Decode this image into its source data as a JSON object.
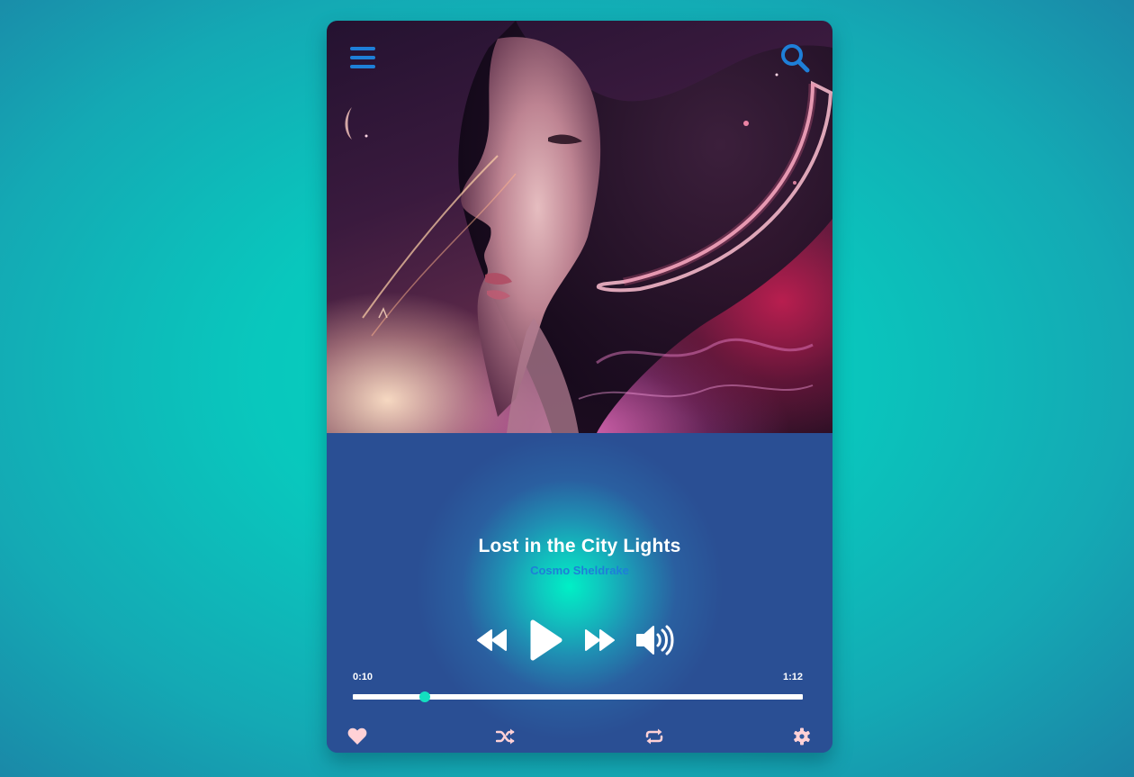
{
  "player": {
    "song_title": "Lost in the City Lights",
    "artist": "Cosmo Sheldrake",
    "current_time": "0:10",
    "total_time": "1:12",
    "progress_fraction": 0.16
  },
  "icons": {
    "menu": "hamburger-menu-icon",
    "search": "search-icon",
    "rewind": "rewind-icon",
    "play": "play-icon",
    "forward": "fast-forward-icon",
    "volume": "volume-icon",
    "favorite": "heart-icon",
    "shuffle": "shuffle-icon",
    "repeat": "repeat-icon",
    "settings": "gear-icon"
  },
  "colors": {
    "accent_blue": "#1e7fd8",
    "progress_thumb": "#13dfc0",
    "bottom_icons": "#ffd1d6",
    "controls": "#ffffff"
  }
}
